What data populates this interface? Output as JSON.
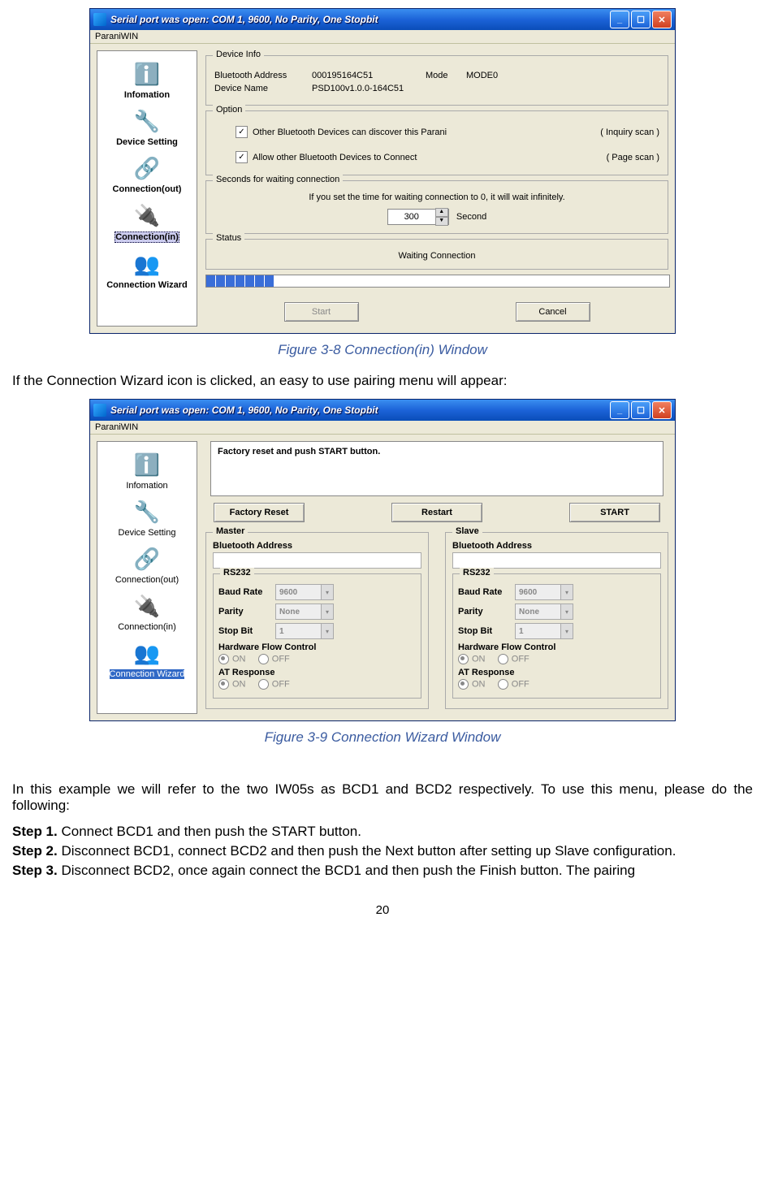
{
  "window": {
    "title": "Serial port was open: COM 1, 9600, No Parity, One Stopbit",
    "menu": "ParaniWIN"
  },
  "sidebar": {
    "items": [
      {
        "label": "Infomation"
      },
      {
        "label": "Device Setting"
      },
      {
        "label": "Connection(out)"
      },
      {
        "label": "Connection(in)"
      },
      {
        "label": "Connection Wizard"
      }
    ]
  },
  "fig1": {
    "device_info": {
      "legend": "Device Info",
      "addr_label": "Bluetooth Address",
      "addr_value": "000195164C51",
      "mode_label": "Mode",
      "mode_value": "MODE0",
      "name_label": "Device Name",
      "name_value": "PSD100v1.0.0-164C51"
    },
    "option": {
      "legend": "Option",
      "opt1": "Other Bluetooth Devices can discover this Parani",
      "opt1_hint": "( Inquiry scan )",
      "opt2": "Allow other Bluetooth Devices to Connect",
      "opt2_hint": "( Page scan )"
    },
    "wait": {
      "legend": "Seconds for waiting connection",
      "note": "If you set the time for waiting connection to 0, it will wait infinitely.",
      "value": "300",
      "unit": "Second"
    },
    "status": {
      "legend": "Status",
      "text": "Waiting Connection"
    },
    "buttons": {
      "start": "Start",
      "cancel": "Cancel"
    },
    "caption": "Figure 3-8 Connection(in) Window"
  },
  "mid_para": "If the Connection Wizard icon is clicked, an easy to use pairing menu will appear:",
  "fig2": {
    "instr": "Factory reset and push START button.",
    "buttons": {
      "factory": "Factory Reset",
      "restart": "Restart",
      "start": "START"
    },
    "master": {
      "legend": "Master",
      "bt_label": "Bluetooth Address",
      "rs232": "RS232",
      "baud": "Baud Rate",
      "baud_v": "9600",
      "parity": "Parity",
      "parity_v": "None",
      "stop": "Stop Bit",
      "stop_v": "1",
      "hfc": "Hardware Flow Control",
      "at": "AT Response",
      "on": "ON",
      "off": "OFF"
    },
    "slave": {
      "legend": "Slave",
      "bt_label": "Bluetooth Address",
      "rs232": "RS232",
      "baud": "Baud Rate",
      "baud_v": "9600",
      "parity": "Parity",
      "parity_v": "None",
      "stop": "Stop Bit",
      "stop_v": "1",
      "hfc": "Hardware Flow Control",
      "at": "AT Response",
      "on": "ON",
      "off": "OFF"
    },
    "caption": "Figure 3-9 Connection Wizard Window"
  },
  "para2": "In this example we will refer to the two IW05s as BCD1 and BCD2 respectively. To use this menu, please do the following:",
  "step1_b": "Step 1.",
  "step1_t": " Connect BCD1 and then push the START button.",
  "step2_b": "Step 2.",
  "step2_t": " Disconnect BCD1, connect BCD2 and then push the Next button after setting up Slave configuration.",
  "step3_b": "Step 3.",
  "step3_t": " Disconnect BCD2, once again connect the BCD1 and then push the Finish button. The pairing",
  "page_no": "20"
}
